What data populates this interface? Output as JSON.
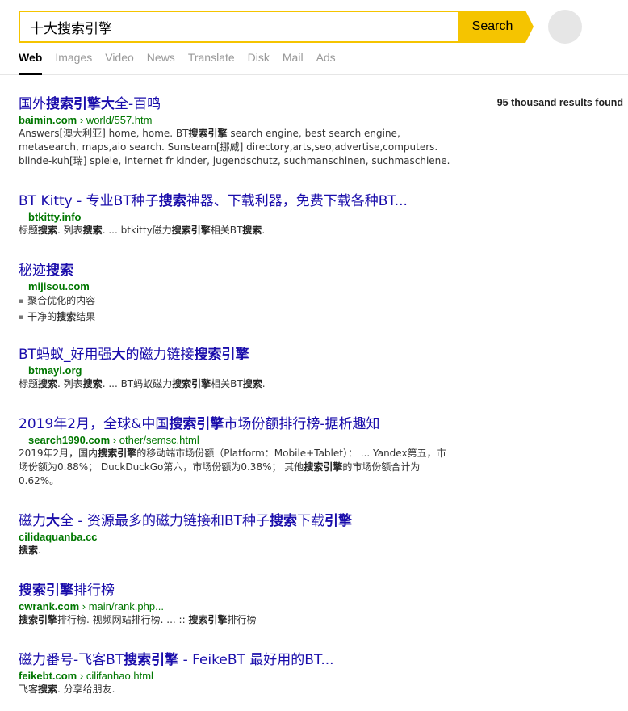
{
  "search": {
    "query": "十大搜索引擎",
    "button_label": "Search"
  },
  "tabs": [
    "Web",
    "Images",
    "Video",
    "News",
    "Translate",
    "Disk",
    "Mail",
    "Ads"
  ],
  "result_count": "95 thousand results found",
  "results": [
    {
      "title_parts": [
        [
          "国外",
          false
        ],
        [
          "搜索引擎",
          true
        ],
        [
          "大",
          true
        ],
        [
          "全-百鸣",
          false
        ]
      ],
      "domain": "baimin.com",
      "path": "› world/557.htm",
      "snippet_parts": [
        [
          "Answers[澳大利亚] home, home. BT",
          false
        ],
        [
          "搜索引擎",
          true
        ],
        [
          " search engine, best search engine, metasearch, maps,aio search. Sunsteam[挪威] directory,arts,seo,advertise,computers. blinde-kuh[瑞] spiele, internet fr kinder, jugendschutz, suchmanschinen, suchmaschiene.",
          false
        ]
      ]
    },
    {
      "title_parts": [
        [
          "BT Kitty - 专业BT种子",
          false
        ],
        [
          "搜索",
          true
        ],
        [
          "神器、下载利器，免费下载各种BT...",
          false
        ]
      ],
      "domain": "btkitty.info",
      "path": "",
      "snippet_parts": [
        [
          "标题",
          false
        ],
        [
          "搜索",
          true
        ],
        [
          ". 列表",
          false
        ],
        [
          "搜索",
          true
        ],
        [
          ". ... btkitty磁力",
          false
        ],
        [
          "搜索引擎",
          true
        ],
        [
          "相关BT",
          false
        ],
        [
          "搜索",
          true
        ],
        [
          ".",
          false
        ]
      ]
    },
    {
      "title_parts": [
        [
          "秘迹",
          false
        ],
        [
          "搜索",
          true
        ]
      ],
      "domain": "mijisou.com",
      "path": "",
      "bullets": [
        [
          [
            "聚合优化的内容",
            false
          ]
        ],
        [
          [
            "干净的",
            false
          ],
          [
            "搜索",
            true
          ],
          [
            "结果",
            false
          ]
        ]
      ]
    },
    {
      "title_parts": [
        [
          "BT蚂蚁_好用强",
          false
        ],
        [
          "大",
          true
        ],
        [
          "的磁力链接",
          false
        ],
        [
          "搜索引擎",
          true
        ]
      ],
      "domain": "btmayi.org",
      "path": "",
      "snippet_parts": [
        [
          "标题",
          false
        ],
        [
          "搜索",
          true
        ],
        [
          ". 列表",
          false
        ],
        [
          "搜索",
          true
        ],
        [
          ". ... BT蚂蚁磁力",
          false
        ],
        [
          "搜索引擎",
          true
        ],
        [
          "相关BT",
          false
        ],
        [
          "搜索",
          true
        ],
        [
          ".",
          false
        ]
      ]
    },
    {
      "title_parts": [
        [
          "2019年2月，全球&中国",
          false
        ],
        [
          "搜索引擎",
          true
        ],
        [
          "市场份额排行榜-据析趣知",
          false
        ]
      ],
      "domain": "search1990.com",
      "path": "› other/semsc.html",
      "snippet_parts": [
        [
          "2019年2月，国内",
          false
        ],
        [
          "搜索引擎",
          true
        ],
        [
          "的移动端市场份额（Platform：Mobile+Tablet）： ... Yandex第五，市场份额为0.88%； DuckDuckGo第六，市场份额为0.38%； 其他",
          false
        ],
        [
          "搜索引擎",
          true
        ],
        [
          "的市场份额合计为0.62%。",
          false
        ]
      ]
    },
    {
      "title_parts": [
        [
          "磁力",
          false
        ],
        [
          "大",
          true
        ],
        [
          "全 - 资源最多的磁力链接和BT种子",
          false
        ],
        [
          "搜索",
          true
        ],
        [
          "下载",
          false
        ],
        [
          "引擎",
          true
        ]
      ],
      "domain": "cilidaquanba.cc",
      "path": "",
      "snippet_parts": [
        [
          "搜索",
          true
        ],
        [
          ".",
          false
        ]
      ]
    },
    {
      "title_parts": [
        [
          "搜索引擎",
          true
        ],
        [
          "排行榜",
          false
        ]
      ],
      "domain": "cwrank.com",
      "path": "› main/rank.php...",
      "snippet_parts": [
        [
          "搜索引擎",
          true
        ],
        [
          "排行榜. 视频网站排行榜. ... :: ",
          false
        ],
        [
          "搜索引擎",
          true
        ],
        [
          "排行榜",
          false
        ]
      ]
    },
    {
      "title_parts": [
        [
          "磁力番号-飞客BT",
          false
        ],
        [
          "搜索引擎",
          true
        ],
        [
          " - FeikeBT 最好用的BT...",
          false
        ]
      ],
      "domain": "feikebt.com",
      "path": "› cilifanhao.html",
      "snippet_parts": [
        [
          "飞客",
          false
        ],
        [
          "搜索",
          true
        ],
        [
          ". 分享给朋友.",
          false
        ]
      ]
    }
  ],
  "colors": {
    "accent": "#f5c400",
    "title_link": "#1a0dab",
    "url_green": "#007700"
  }
}
